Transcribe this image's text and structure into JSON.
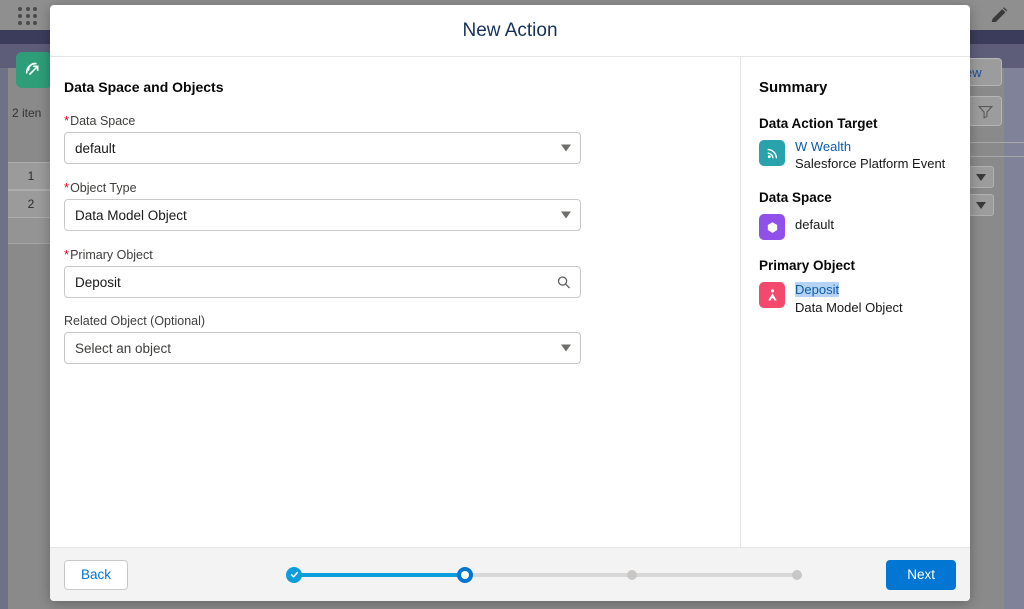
{
  "background": {
    "app_launcher_icon": "app-launcher-grid-icon",
    "app_icon": "data-cloud-app-icon",
    "items_count_label": "2 iten",
    "row_numbers": [
      "1",
      "2"
    ],
    "new_button_label": "ew",
    "filter_icon": "filter-funnel-icon",
    "edit_icon": "pencil-edit-icon"
  },
  "modal": {
    "title": "New Action",
    "form": {
      "section_title": "Data Space and Objects",
      "fields": [
        {
          "label": "Data Space",
          "required": true,
          "value": "default",
          "control": "dropdown",
          "icon": "chevron-down-icon"
        },
        {
          "label": "Object Type",
          "required": true,
          "value": "Data Model Object",
          "control": "dropdown",
          "icon": "chevron-down-icon"
        },
        {
          "label": "Primary Object",
          "required": true,
          "value": "Deposit",
          "control": "lookup",
          "icon": "search-icon"
        },
        {
          "label": "Related Object (Optional)",
          "required": false,
          "value": "Select an object",
          "control": "dropdown",
          "icon": "chevron-down-icon"
        }
      ]
    },
    "summary": {
      "title": "Summary",
      "groups": [
        {
          "heading": "Data Action Target",
          "icon": "platform-event-icon",
          "icon_color": "#28a3ac",
          "primary": "W Wealth",
          "primary_link": true,
          "primary_selected": false,
          "secondary": "Salesforce Platform Event"
        },
        {
          "heading": "Data Space",
          "icon": "data-space-hexagon-icon",
          "icon_color": "#9050e9",
          "primary": "default",
          "primary_link": false,
          "primary_selected": false,
          "secondary": ""
        },
        {
          "heading": "Primary Object",
          "icon": "data-model-object-icon",
          "icon_color": "#f4496d",
          "primary": "Deposit",
          "primary_link": true,
          "primary_selected": true,
          "secondary": "Data Model Object"
        }
      ]
    },
    "footer": {
      "back_label": "Back",
      "next_label": "Next",
      "progress": {
        "total_steps": 4,
        "current_step": 2,
        "steps": [
          "done",
          "active",
          "pending",
          "pending"
        ]
      }
    }
  },
  "colors": {
    "brand_blue": "#0176d3",
    "link_blue": "#0b5cab",
    "required_red": "#ea001e",
    "progress_blue": "#0d9dda",
    "selection_blue": "#b6d3f5"
  }
}
